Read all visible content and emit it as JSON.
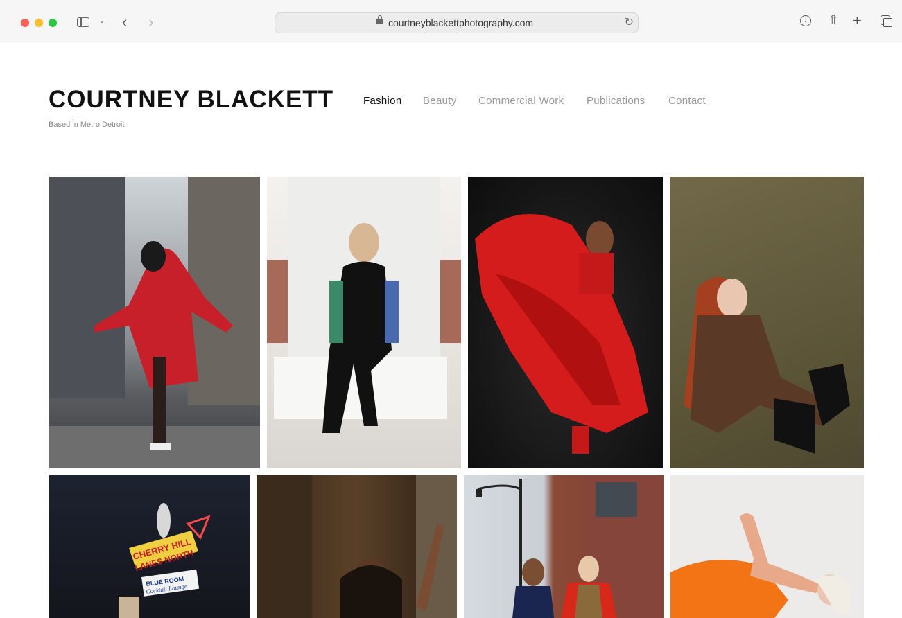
{
  "browser": {
    "url": "courtneyblackettphotography.com",
    "icons": [
      "sidebar-icon",
      "chevron-down-icon",
      "back-icon",
      "forward-icon",
      "lock-icon",
      "reload-icon",
      "download-icon",
      "share-icon",
      "new-tab-icon",
      "tab-overview-icon"
    ]
  },
  "site": {
    "title": "COURTNEY BLACKETT",
    "tagline": "Based in Metro Detroit"
  },
  "nav": {
    "items": [
      {
        "label": "Fashion",
        "active": true
      },
      {
        "label": "Beauty",
        "active": false
      },
      {
        "label": "Commercial Work",
        "active": false
      },
      {
        "label": "Publications",
        "active": false
      },
      {
        "label": "Contact",
        "active": false
      }
    ]
  },
  "gallery": {
    "photos": [
      {
        "subject": "woman in red coat in city"
      },
      {
        "subject": "woman seated on white steps"
      },
      {
        "subject": "woman in red tulle dress"
      },
      {
        "subject": "red-haired woman seated"
      },
      {
        "subject": "bowling alley neon sign"
      },
      {
        "subject": "woman by window"
      },
      {
        "subject": "two women on street"
      },
      {
        "subject": "woman in orange reclining"
      }
    ],
    "sign_texts": [
      "CHERRY HILL",
      "LANES NORTH",
      "BLUE ROOM",
      "Cocktail Lounge"
    ]
  }
}
